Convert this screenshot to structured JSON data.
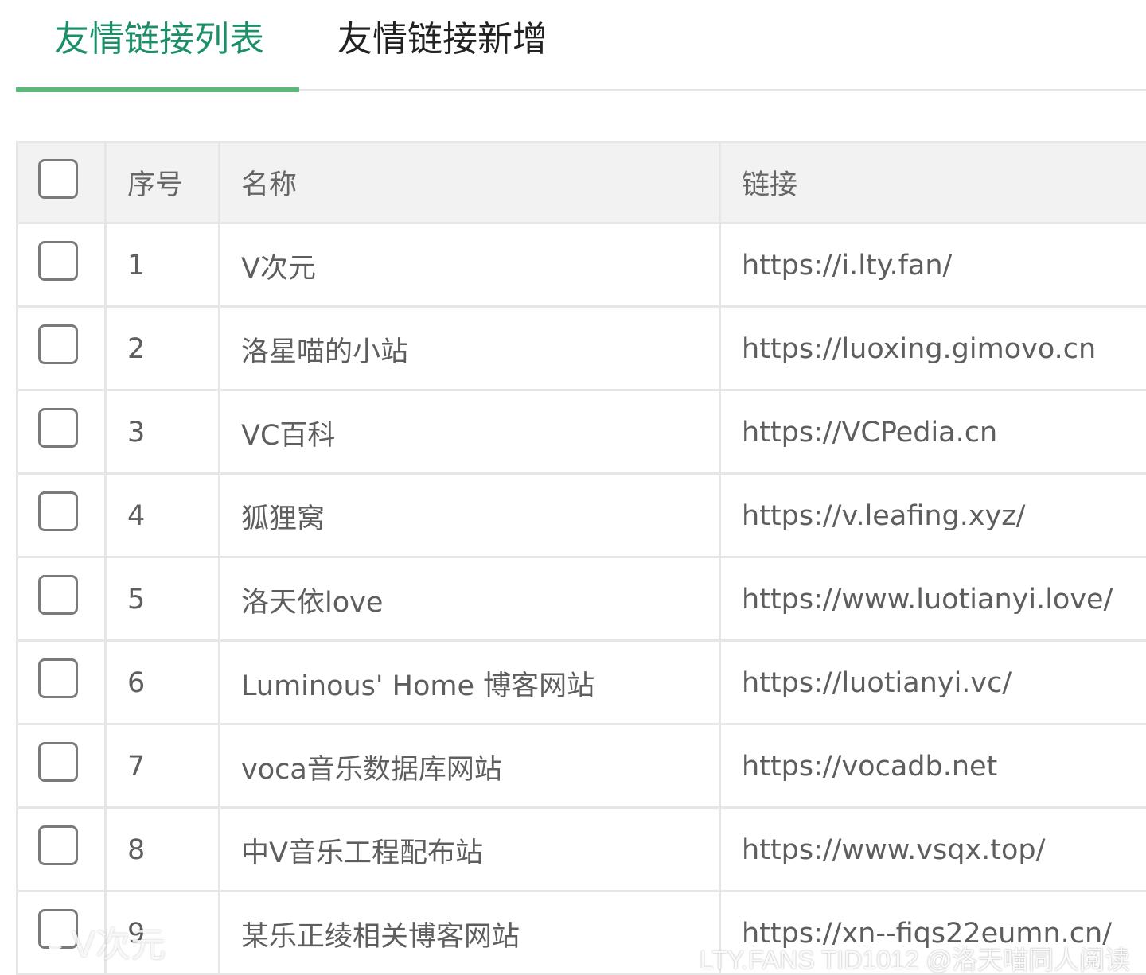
{
  "tabs": [
    {
      "label": "友情链接列表",
      "active": true
    },
    {
      "label": "友情链接新增",
      "active": false
    }
  ],
  "colors": {
    "active_tab_text": "#1c8e68",
    "active_tab_indicator": "#5cb878",
    "header_bg": "#f2f2f2",
    "border": "#e6e6e6"
  },
  "table": {
    "headers": {
      "select_all": "checkbox",
      "num": "序号",
      "name": "名称",
      "link": "链接"
    },
    "rows": [
      {
        "num": "1",
        "name": "V次元",
        "link": "https://i.lty.fan/"
      },
      {
        "num": "2",
        "name": "洛星喵的小站",
        "link": "https://luoxing.gimovo.cn"
      },
      {
        "num": "3",
        "name": "VC百科",
        "link": "https://VCPedia.cn"
      },
      {
        "num": "4",
        "name": "狐狸窝",
        "link": "https://v.leafing.xyz/"
      },
      {
        "num": "5",
        "name": "洛天依love",
        "link": "https://www.luotianyi.love/"
      },
      {
        "num": "6",
        "name": "Luminous' Home  博客网站",
        "link": "https://luotianyi.vc/"
      },
      {
        "num": "7",
        "name": "voca音乐数据库网站",
        "link": "https://vocadb.net"
      },
      {
        "num": "8",
        "name": "中V音乐工程配布站",
        "link": "https://www.vsqx.top/"
      },
      {
        "num": "9",
        "name": "某乐正绫相关博客网站",
        "link": "https://xn--fiqs22eumn.cn/"
      }
    ]
  },
  "watermark": {
    "logo_icon": "play-icon",
    "logo_text": "V次元",
    "text": "LTY.FANS  TID1012  @洛天喵同人阅读"
  }
}
